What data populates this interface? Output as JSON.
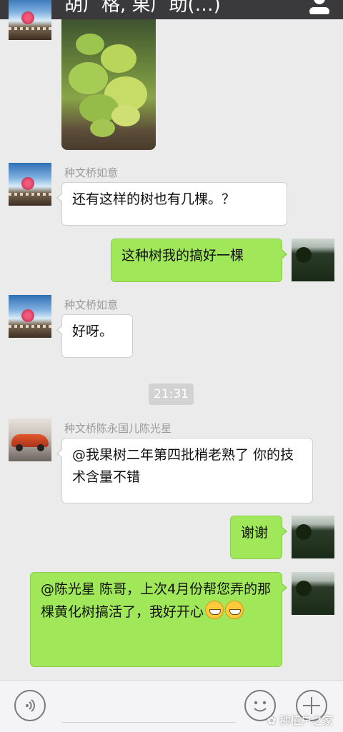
{
  "header": {
    "back_icon": "chevron-left-icon",
    "title": "胡广格, 果广助(…)",
    "person_icon": "person-icon"
  },
  "messages": [
    {
      "sender": "me",
      "type": "image"
    },
    {
      "sender": "种文桥如意",
      "type": "text",
      "text": "还有这样的树也有几棵。？"
    },
    {
      "sender": "me",
      "type": "text",
      "text": "这种树我的搞好一棵"
    },
    {
      "sender": "种文桥如意",
      "type": "text",
      "text": "好呀。"
    },
    {
      "type": "time",
      "text": "21:31"
    },
    {
      "sender": "种文桥陈永国儿陈光星",
      "type": "text",
      "text": "@我果树二年第四批梢老熟了 你的技术含量不错"
    },
    {
      "sender": "me",
      "type": "text",
      "text": "谢谢"
    },
    {
      "sender": "me",
      "type": "text",
      "text": "@陈光星 陈哥，上次4月份帮您弄的那棵黄化树搞活了，我好开心",
      "emojis": [
        "grin-emoji",
        "grin-emoji"
      ]
    }
  ],
  "toolbar": {
    "voice_icon": "voice-icon",
    "emoji_icon": "smiley-icon",
    "plus_icon": "plus-icon"
  },
  "watermark": "种植户之家",
  "colors": {
    "background": "#ebebeb",
    "bubble_in": "#ffffff",
    "bubble_out": "#a0e75a",
    "header": "#3a3a3c"
  }
}
